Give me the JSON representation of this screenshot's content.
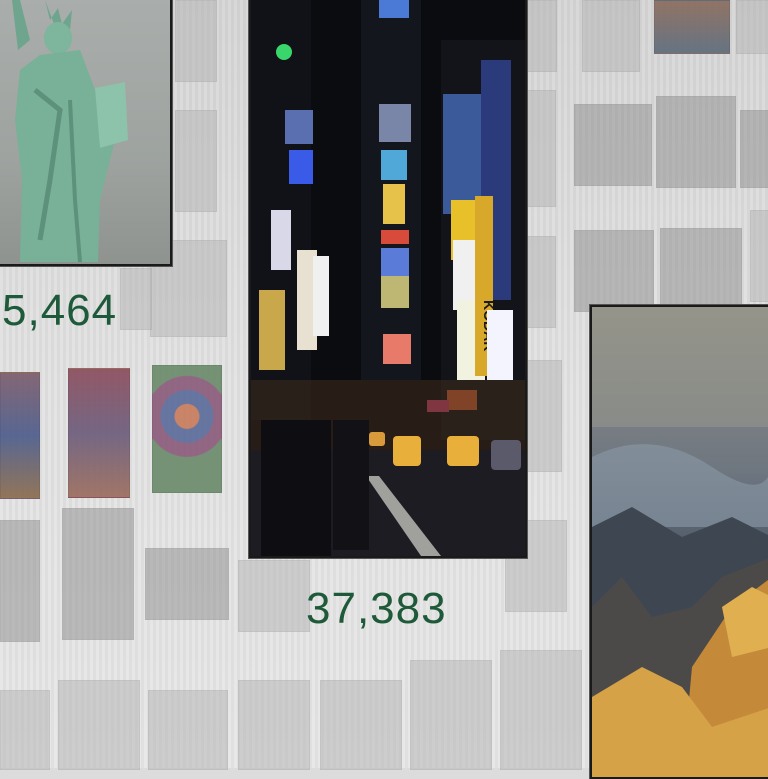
{
  "counts": {
    "left": "5,464",
    "center": "37,383"
  },
  "photos": {
    "left": {
      "subject": "statue-of-liberty"
    },
    "center": {
      "subject": "times-square-night",
      "sign_text": "KODAK"
    },
    "right": {
      "subject": "grand-canyon"
    }
  },
  "colors": {
    "count_text": "#1e5a3a",
    "background": "#dcdcdc"
  }
}
